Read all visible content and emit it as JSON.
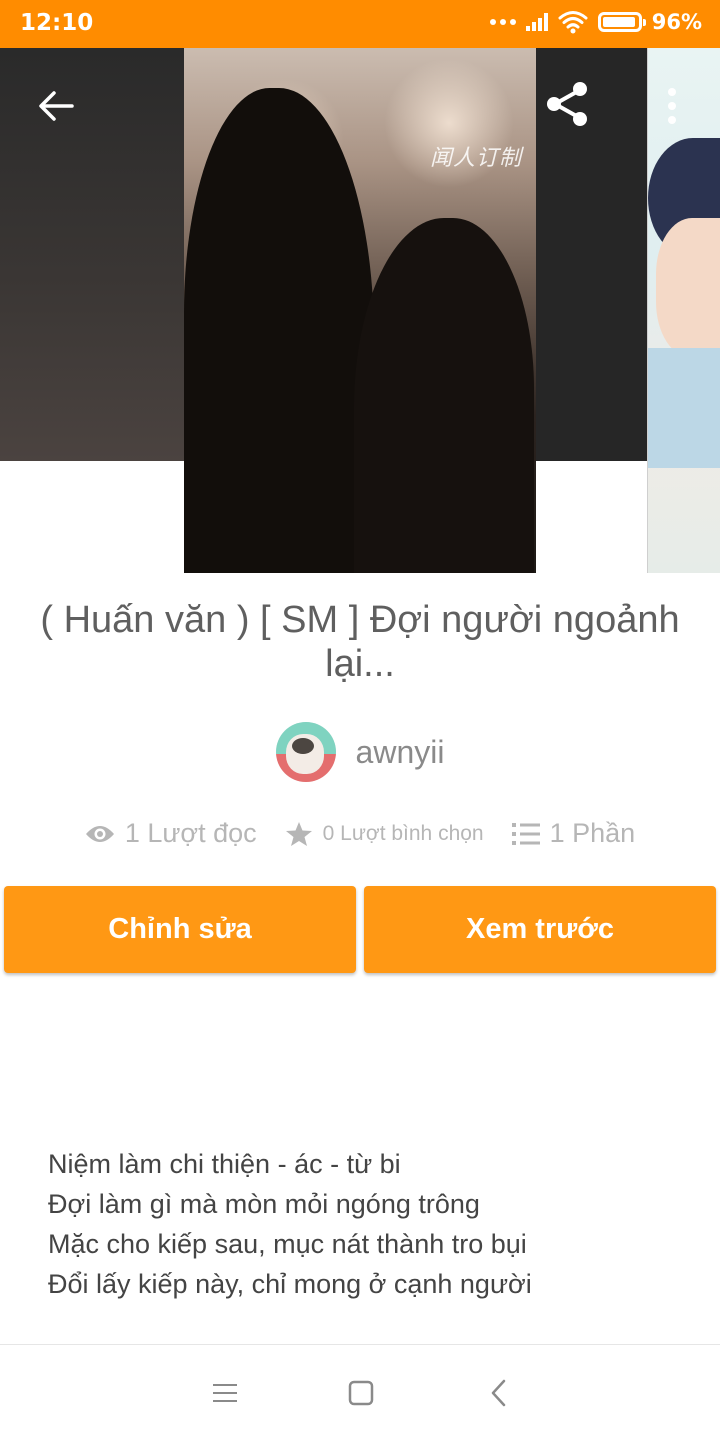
{
  "status_bar": {
    "time": "12:10",
    "battery": "96%",
    "battery_level": 0.96
  },
  "toolbar": {
    "back_icon": "arrow-left-icon",
    "share_icon": "share-icon",
    "more_icon": "more-vertical-icon"
  },
  "cover": {
    "text": "闻人订制"
  },
  "story": {
    "title": "( Huấn văn ) [ SM ] Đợi người ngoảnh lại...",
    "author": "awnyii"
  },
  "stats": {
    "reads": "1 Lượt đọc",
    "votes": "0 Lượt bình chọn",
    "parts": "1 Phần"
  },
  "actions": {
    "edit": "Chỉnh sửa",
    "preview": "Xem trước"
  },
  "description": {
    "lines": [
      "Niệm làm chi thiện - ác - từ bi",
      "Đợi làm gì mà mòn mỏi ngóng trông",
      "Mặc cho kiếp sau, mục nát thành tro bụi",
      "Đổi lấy kiếp này, chỉ mong ở cạnh người"
    ]
  },
  "colors": {
    "accent": "#ff8c00",
    "button": "#ff9814"
  }
}
